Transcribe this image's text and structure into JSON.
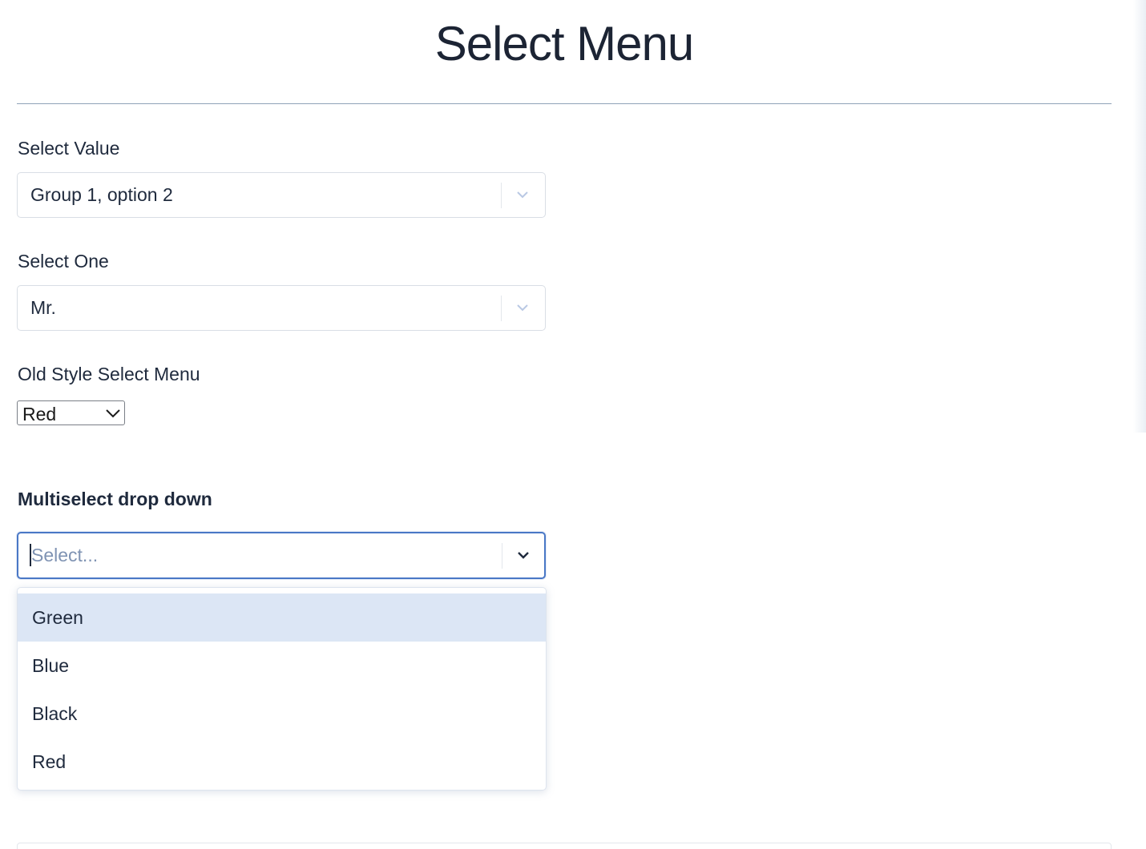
{
  "page": {
    "title": "Select Menu"
  },
  "fields": {
    "select_value": {
      "label": "Select Value",
      "value": "Group 1, option 2",
      "indicator_icon": "chevron-down-icon"
    },
    "select_one": {
      "label": "Select One",
      "value": "Mr.",
      "indicator_icon": "chevron-down-icon"
    },
    "old_style": {
      "label": "Old Style Select Menu",
      "value": "Red"
    },
    "multiselect": {
      "label": "Multiselect drop down",
      "placeholder": "Select...",
      "focused": true,
      "menu_open": true,
      "options": [
        "Green",
        "Blue",
        "Black",
        "Red"
      ],
      "highlighted_option": "Green"
    }
  },
  "colors": {
    "accent_focus": "#4a78c6",
    "option_highlight": "#dce6f5",
    "text": "#1f2a3d",
    "placeholder": "#7f93b3"
  }
}
